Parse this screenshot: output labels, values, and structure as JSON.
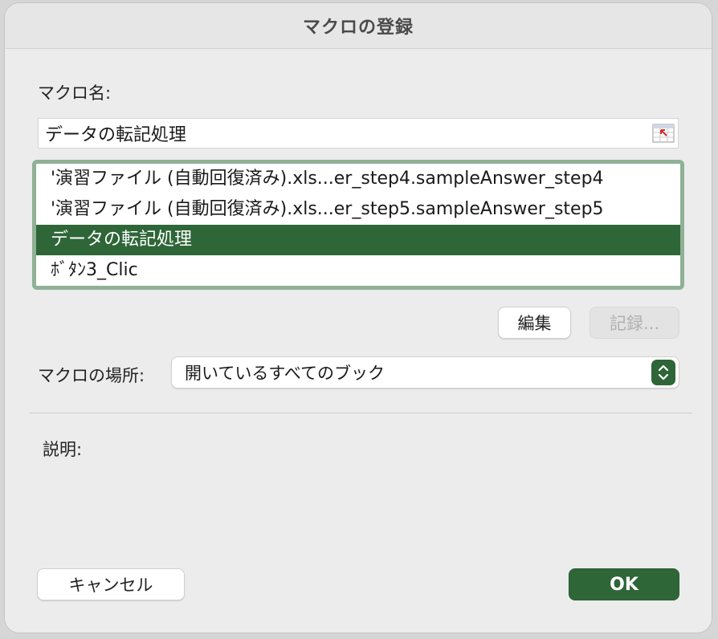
{
  "window": {
    "title": "マクロの登録"
  },
  "macro_name": {
    "label": "マクロ名:",
    "value": "データの転記処理",
    "collapse_icon": "range-select-icon"
  },
  "macro_list": {
    "items": [
      "'演習ファイル (自動回復済み).xls...er_step4.sampleAnswer_step4",
      "'演習ファイル (自動回復済み).xls...er_step5.sampleAnswer_step5",
      "データの転記処理",
      "ﾎﾞﾀﾝ3_Clic"
    ],
    "selected_index": 2
  },
  "buttons": {
    "edit": "編集",
    "record": "記録...",
    "cancel": "キャンセル",
    "ok": "OK"
  },
  "location": {
    "label": "マクロの場所:",
    "selected": "開いているすべてのブック"
  },
  "description": {
    "label": "説明:"
  },
  "colors": {
    "accent": "#2e6638",
    "list_border": "#8fb196"
  }
}
